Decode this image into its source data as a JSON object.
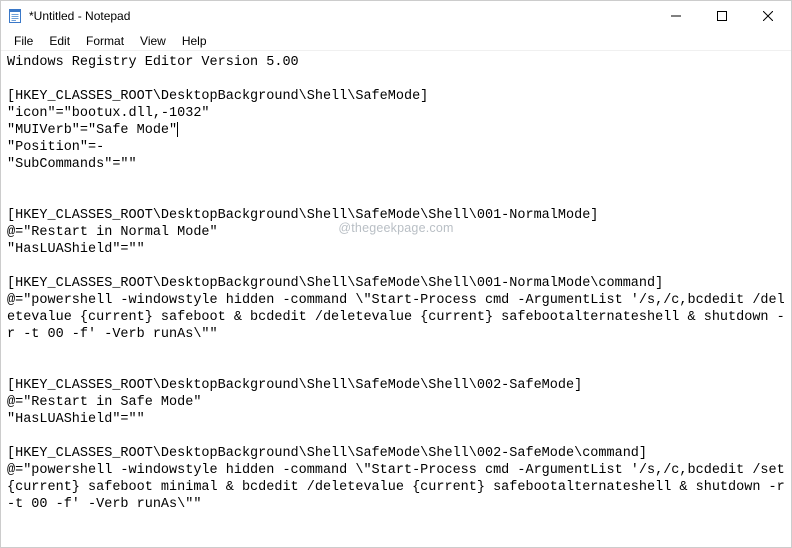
{
  "window": {
    "title": "*Untitled - Notepad"
  },
  "menu": {
    "file": "File",
    "edit": "Edit",
    "format": "Format",
    "view": "View",
    "help": "Help"
  },
  "watermark": "@thegeekpage.com",
  "content": {
    "l1": "Windows Registry Editor Version 5.00",
    "l2": "",
    "l3": "[HKEY_CLASSES_ROOT\\DesktopBackground\\Shell\\SafeMode]",
    "l4": "\"icon\"=\"bootux.dll,-1032\"",
    "l5a": "\"MUIVerb\"=\"Safe Mode\"",
    "l6": "\"Position\"=-",
    "l7": "\"SubCommands\"=\"\"",
    "l8": "",
    "l9": "",
    "l10": "[HKEY_CLASSES_ROOT\\DesktopBackground\\Shell\\SafeMode\\Shell\\001-NormalMode]",
    "l11": "@=\"Restart in Normal Mode\"",
    "l12": "\"HasLUAShield\"=\"\"",
    "l13": "",
    "l14": "[HKEY_CLASSES_ROOT\\DesktopBackground\\Shell\\SafeMode\\Shell\\001-NormalMode\\command]",
    "l15": "@=\"powershell -windowstyle hidden -command \\\"Start-Process cmd -ArgumentList '/s,/c,bcdedit /deletevalue {current} safeboot & bcdedit /deletevalue {current} safebootalternateshell & shutdown -r -t 00 -f' -Verb runAs\\\"\"",
    "l16": "",
    "l17": "",
    "l18": "[HKEY_CLASSES_ROOT\\DesktopBackground\\Shell\\SafeMode\\Shell\\002-SafeMode]",
    "l19": "@=\"Restart in Safe Mode\"",
    "l20": "\"HasLUAShield\"=\"\"",
    "l21": "",
    "l22": "[HKEY_CLASSES_ROOT\\DesktopBackground\\Shell\\SafeMode\\Shell\\002-SafeMode\\command]",
    "l23": "@=\"powershell -windowstyle hidden -command \\\"Start-Process cmd -ArgumentList '/s,/c,bcdedit /set {current} safeboot minimal & bcdedit /deletevalue {current} safebootalternateshell & shutdown -r -t 00 -f' -Verb runAs\\\"\""
  }
}
